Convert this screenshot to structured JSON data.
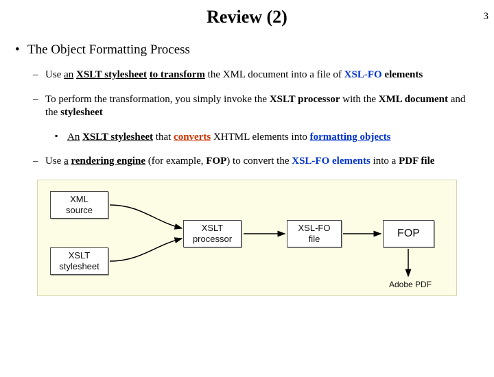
{
  "page_number": "3",
  "title": "Review (2)",
  "heading": "The Object Formatting Process",
  "bullets": {
    "b1": {
      "t1": "Use ",
      "t2": "an",
      "t3": " ",
      "t4": "XSLT stylesheet",
      "t5": " ",
      "t6": "to transform",
      "t7": " the XML document into a file of ",
      "t8": "XSL-FO",
      "t9": " ",
      "t10": "elements"
    },
    "b2": {
      "t1": "To perform the transformation, you simply invoke the ",
      "t2": "XSLT processor",
      "t3": " with the ",
      "t4": "XML document",
      "t5": " and the ",
      "t6": "stylesheet"
    },
    "b3": {
      "t1": "An",
      "t2": " ",
      "t3": "XSLT stylesheet",
      "t4": " that ",
      "t5": "converts",
      "t6": " XHTML elements into ",
      "t7": "formatting objects"
    },
    "b4": {
      "t1": "Use ",
      "t2": "a",
      "t3": " ",
      "t4": "rendering engine",
      "t5": " (for example, ",
      "t6": "FOP",
      "t7": ") to convert the ",
      "t8": "XSL-FO elements",
      "t9": " into a ",
      "t10": "PDF file"
    }
  },
  "diagram": {
    "box1": "XML\nsource",
    "box2": "XSLT\nstylesheet",
    "box3": "XSLT\nprocessor",
    "box4": "XSL-FO\nfile",
    "box5": "FOP",
    "caption": "Adobe PDF"
  }
}
